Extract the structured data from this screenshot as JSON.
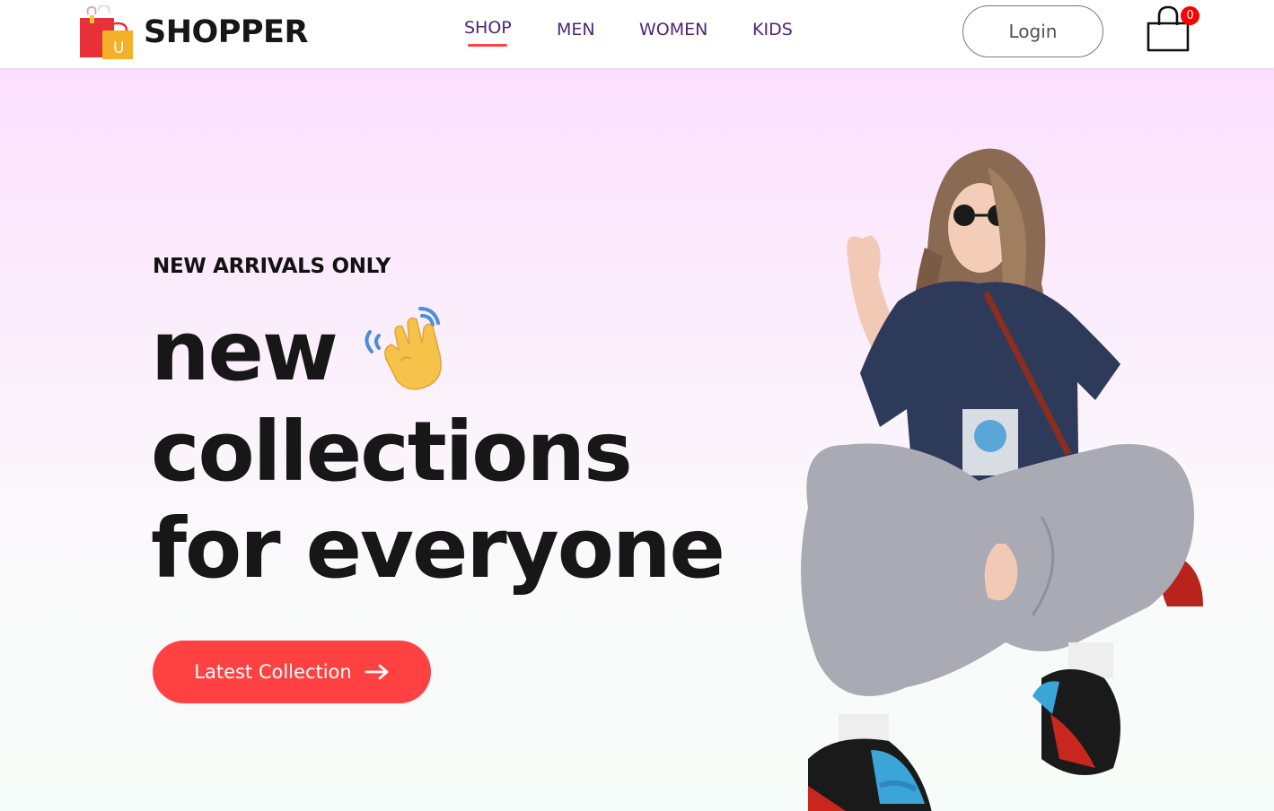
{
  "brand": {
    "name": "SHOPPER",
    "logo_icon": "shopping-bag-logo-icon",
    "logo_letter": "U"
  },
  "nav": {
    "items": [
      {
        "label": "SHOP",
        "active": true
      },
      {
        "label": "MEN",
        "active": false
      },
      {
        "label": "WOMEN",
        "active": false
      },
      {
        "label": "KIDS",
        "active": false
      }
    ]
  },
  "header": {
    "login_label": "Login",
    "cart_icon": "shopping-bag-icon",
    "cart_count": "0"
  },
  "hero": {
    "eyebrow": "NEW ARRIVALS ONLY",
    "headline": [
      "new",
      "collections",
      "for everyone"
    ],
    "wave_icon": "waving-hand-icon",
    "cta_label": "Latest Collection",
    "cta_icon": "arrow-right-icon",
    "image": "model-photo"
  },
  "colors": {
    "accent": "#ff4141",
    "nav_text": "#4c2679",
    "cart_badge": "#ff0000",
    "hero_gradient_top": "#fbe0fd",
    "hero_gradient_bottom": "#f6fcf9"
  }
}
